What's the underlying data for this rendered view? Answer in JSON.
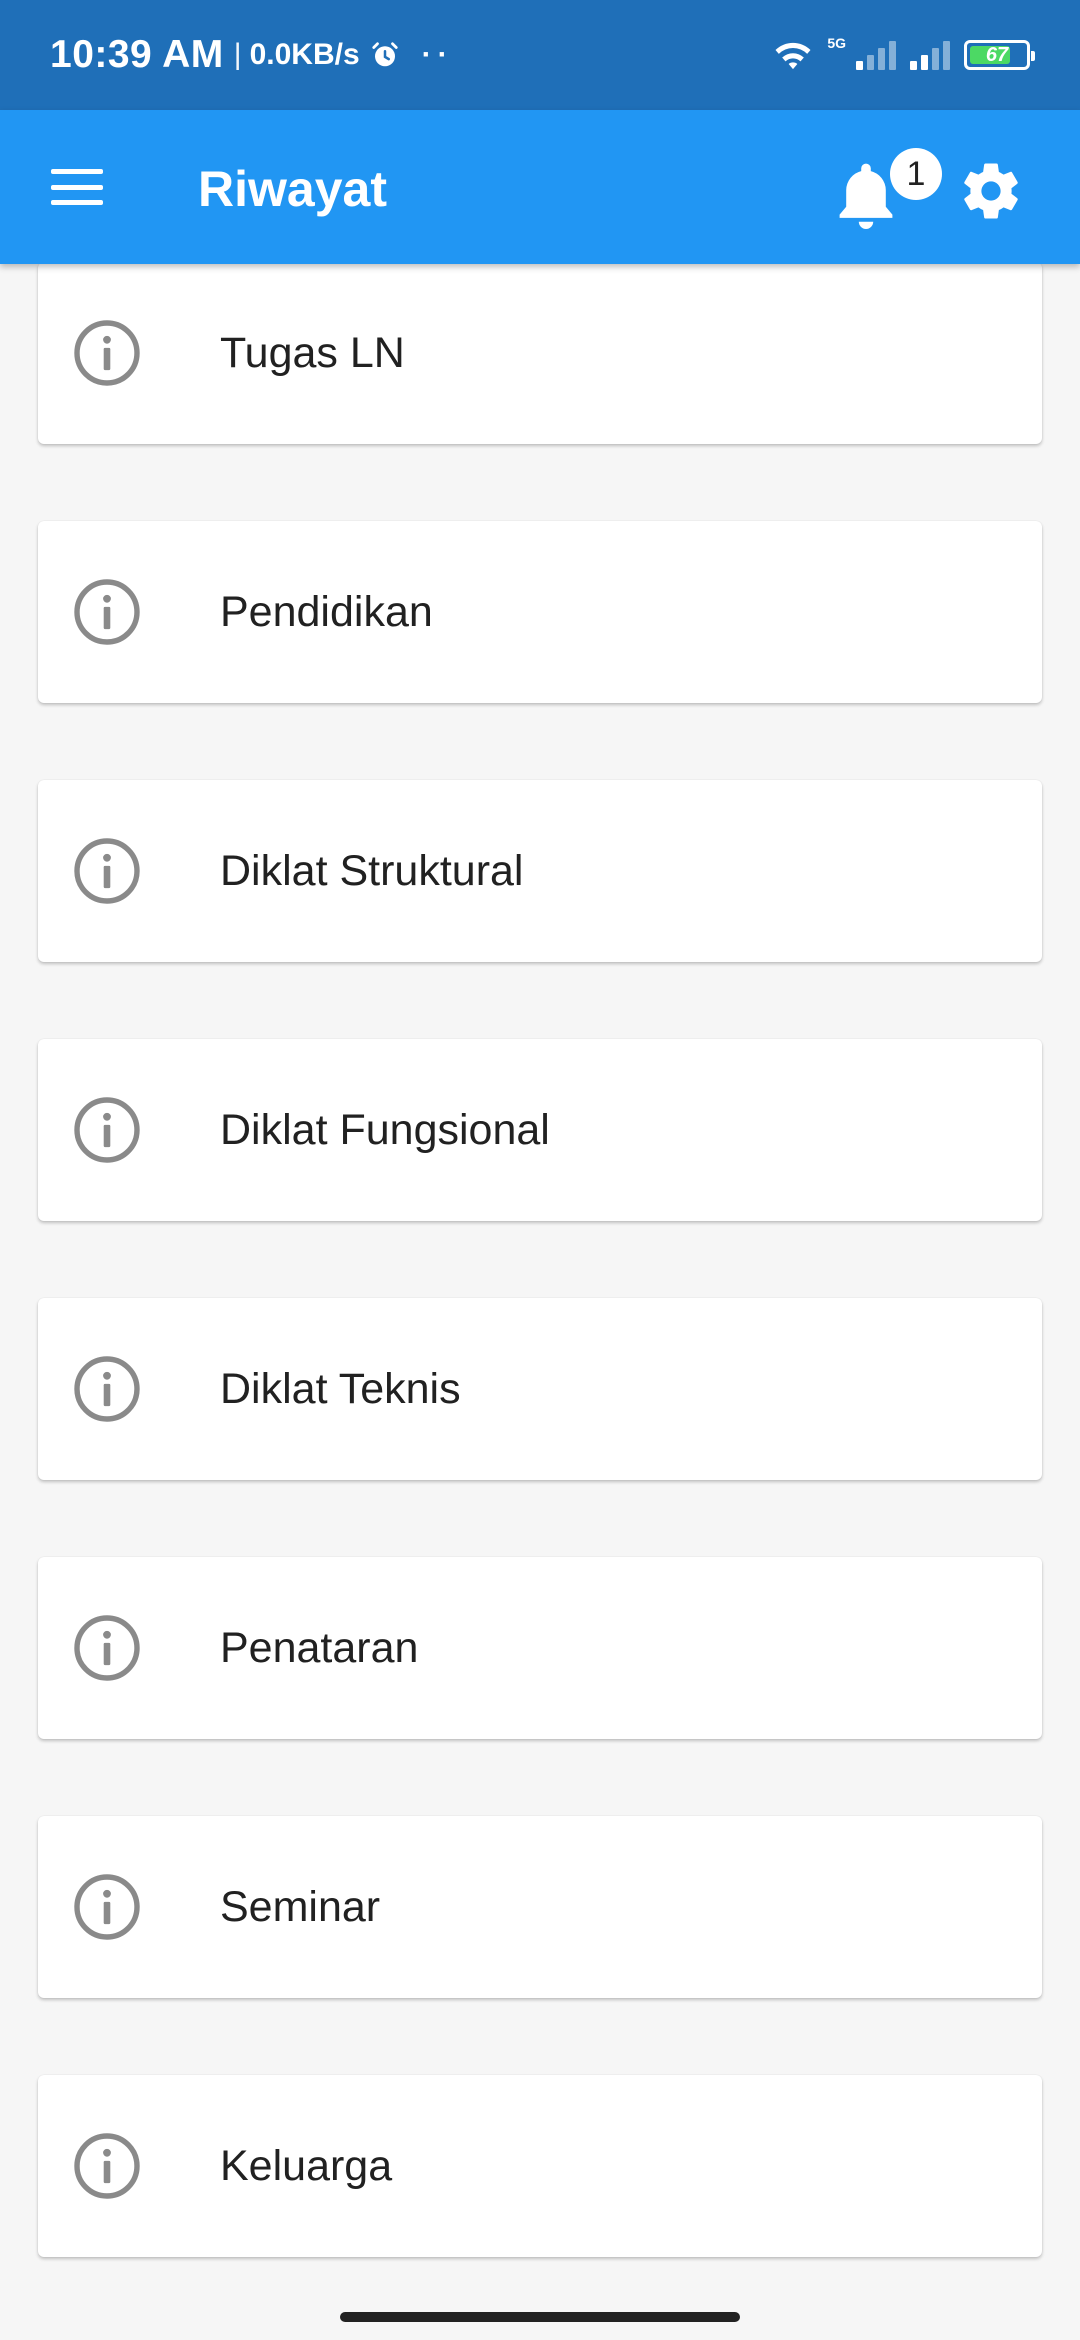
{
  "status_bar": {
    "time": "10:39 AM",
    "separator": "|",
    "speed": "0.0KB/s",
    "dots": "··",
    "network_label": "5G",
    "battery": "67"
  },
  "app_bar": {
    "title": "Riwayat",
    "notification_count": "1",
    "color": "#2196f3"
  },
  "menu_items": [
    {
      "label": "Tugas LN",
      "icon": "info-icon"
    },
    {
      "label": "Pendidikan",
      "icon": "info-icon"
    },
    {
      "label": "Diklat Struktural",
      "icon": "info-icon"
    },
    {
      "label": "Diklat Fungsional",
      "icon": "info-icon"
    },
    {
      "label": "Diklat Teknis",
      "icon": "info-icon"
    },
    {
      "label": "Penataran",
      "icon": "info-icon"
    },
    {
      "label": "Seminar",
      "icon": "info-icon"
    },
    {
      "label": "Keluarga",
      "icon": "info-icon"
    }
  ]
}
